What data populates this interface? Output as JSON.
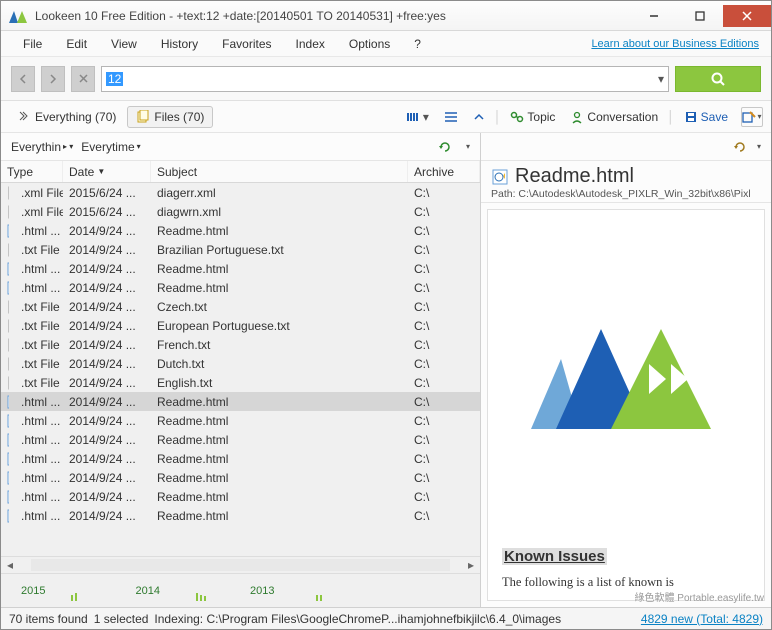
{
  "window": {
    "title": "Lookeen 10 Free Edition - +text:12 +date:[20140501 TO 20140531] +free:yes"
  },
  "menu": {
    "file": "File",
    "edit": "Edit",
    "view": "View",
    "history": "History",
    "favorites": "Favorites",
    "index": "Index",
    "options": "Options",
    "help": "?",
    "biz_link": "Learn about our Business Editions"
  },
  "search": {
    "value": "12"
  },
  "tabs": {
    "everything": "Everything (70)",
    "files": "Files (70)"
  },
  "toolbar": {
    "topic": "Topic",
    "conversation": "Conversation",
    "save": "Save"
  },
  "filters": {
    "scope": "Everythin",
    "time": "Everytime"
  },
  "columns": {
    "type": "Type",
    "date": "Date",
    "subject": "Subject",
    "archive": "Archive"
  },
  "rows": [
    {
      "icon": "xml",
      "type": ".xml File",
      "date": "2015/6/24 ...",
      "subject": "diagerr.xml",
      "archive": "C:\\"
    },
    {
      "icon": "xml",
      "type": ".xml File",
      "date": "2015/6/24 ...",
      "subject": "diagwrn.xml",
      "archive": "C:\\"
    },
    {
      "icon": "html",
      "type": ".html ...",
      "date": "2014/9/24 ...",
      "subject": "Readme.html",
      "archive": "C:\\"
    },
    {
      "icon": "txt",
      "type": ".txt File",
      "date": "2014/9/24 ...",
      "subject": "Brazilian Portuguese.txt",
      "archive": "C:\\"
    },
    {
      "icon": "html",
      "type": ".html ...",
      "date": "2014/9/24 ...",
      "subject": "Readme.html",
      "archive": "C:\\"
    },
    {
      "icon": "html",
      "type": ".html ...",
      "date": "2014/9/24 ...",
      "subject": "Readme.html",
      "archive": "C:\\"
    },
    {
      "icon": "txt",
      "type": ".txt File",
      "date": "2014/9/24 ...",
      "subject": "Czech.txt",
      "archive": "C:\\"
    },
    {
      "icon": "txt",
      "type": ".txt File",
      "date": "2014/9/24 ...",
      "subject": "European Portuguese.txt",
      "archive": "C:\\"
    },
    {
      "icon": "txt",
      "type": ".txt File",
      "date": "2014/9/24 ...",
      "subject": "French.txt",
      "archive": "C:\\"
    },
    {
      "icon": "txt",
      "type": ".txt File",
      "date": "2014/9/24 ...",
      "subject": "Dutch.txt",
      "archive": "C:\\"
    },
    {
      "icon": "txt",
      "type": ".txt File",
      "date": "2014/9/24 ...",
      "subject": "English.txt",
      "archive": "C:\\"
    },
    {
      "icon": "html",
      "type": ".html ...",
      "date": "2014/9/24 ...",
      "subject": "Readme.html",
      "archive": "C:\\",
      "selected": true
    },
    {
      "icon": "html",
      "type": ".html ...",
      "date": "2014/9/24 ...",
      "subject": "Readme.html",
      "archive": "C:\\"
    },
    {
      "icon": "html",
      "type": ".html ...",
      "date": "2014/9/24 ...",
      "subject": "Readme.html",
      "archive": "C:\\"
    },
    {
      "icon": "html",
      "type": ".html ...",
      "date": "2014/9/24 ...",
      "subject": "Readme.html",
      "archive": "C:\\"
    },
    {
      "icon": "html",
      "type": ".html ...",
      "date": "2014/9/24 ...",
      "subject": "Readme.html",
      "archive": "C:\\"
    },
    {
      "icon": "html",
      "type": ".html ...",
      "date": "2014/9/24 ...",
      "subject": "Readme.html",
      "archive": "C:\\"
    },
    {
      "icon": "html",
      "type": ".html ...",
      "date": "2014/9/24 ...",
      "subject": "Readme.html",
      "archive": "C:\\"
    }
  ],
  "timeline": {
    "y1": "2015",
    "y2": "2014",
    "y3": "2013"
  },
  "preview": {
    "title": "Readme.html",
    "path": "Path: C:\\Autodesk\\Autodesk_PIXLR_Win_32bit\\x86\\Pixl",
    "heading": "Known Issues",
    "text": "The following is a list of known is"
  },
  "status": {
    "found": "70 items found",
    "selected": "1 selected",
    "indexing": "Indexing: C:\\Program Files\\GoogleChromeP...ihamjohnefbikjilc\\6.4_0\\images",
    "new_link": "4829 new (Total: 4829)"
  },
  "watermark": "綠色軟體 Portable.easylife.tw"
}
